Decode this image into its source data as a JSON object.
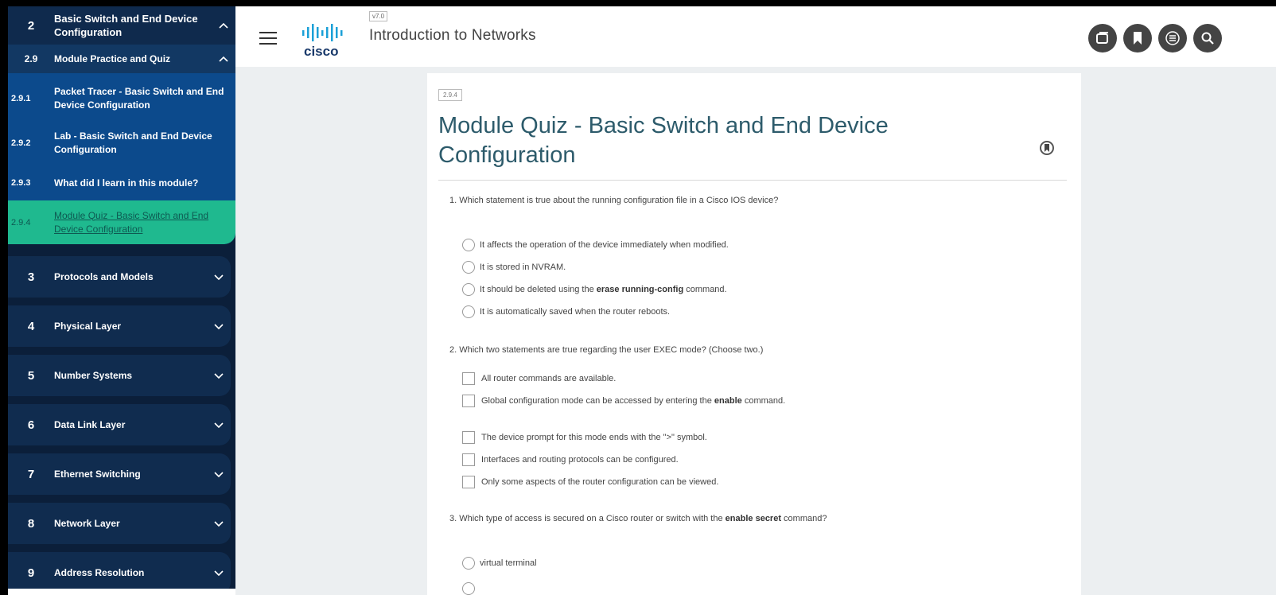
{
  "sidebar": {
    "chapter": {
      "num": "2",
      "label": "Basic Switch and End Device Configuration"
    },
    "section": {
      "num": "2.9",
      "label": "Module Practice and Quiz"
    },
    "subitems": [
      {
        "num": "2.9.1",
        "label": "Packet Tracer - Basic Switch and End Device Configuration"
      },
      {
        "num": "2.9.2",
        "label": "Lab - Basic Switch and End Device Configuration"
      },
      {
        "num": "2.9.3",
        "label": "What did I learn in this module?"
      },
      {
        "num": "2.9.4",
        "label": "Module Quiz - Basic Switch and End Device Configuration"
      }
    ],
    "modules": [
      {
        "num": "3",
        "label": "Protocols and Models"
      },
      {
        "num": "4",
        "label": "Physical Layer"
      },
      {
        "num": "5",
        "label": "Number Systems"
      },
      {
        "num": "6",
        "label": "Data Link Layer"
      },
      {
        "num": "7",
        "label": "Ethernet Switching"
      },
      {
        "num": "8",
        "label": "Network Layer"
      },
      {
        "num": "9",
        "label": "Address Resolution"
      }
    ]
  },
  "header": {
    "version": "v7.0",
    "course_title": "Introduction to Networks",
    "logo_text": "cisco",
    "buttons": [
      "copy-icon",
      "bookmark-icon",
      "list-icon",
      "search-icon"
    ]
  },
  "content": {
    "badge": "2.9.4",
    "title": "Module Quiz - Basic Switch and End Device Configuration",
    "q1": {
      "text": "1. Which statement is true about the running configuration file in a Cisco IOS device?",
      "options": [
        "It affects the operation of the device immediately when modified.",
        "It is stored in NVRAM.",
        "It should be deleted using the ",
        "It is automatically saved when the router reboots."
      ],
      "opt3_bold": "erase running-config",
      "opt3_tail": " command."
    },
    "q2": {
      "text": "2. Which two statements are true regarding the user EXEC mode? (Choose two.)",
      "options": [
        "All router commands are available.",
        "Global configuration mode can be accessed by entering the ",
        "The device prompt for this mode ends with the \">\" symbol.",
        "Interfaces and routing protocols can be configured.",
        "Only some aspects of the router configuration can be viewed."
      ],
      "opt2_bold": "enable",
      "opt2_tail": " command."
    },
    "q3": {
      "text_a": "3. Which type of access is secured on a Cisco router or switch with the ",
      "text_bold1": "enable",
      "text_bold2": "secret",
      "text_tail": " command?",
      "options": [
        "virtual terminal"
      ]
    }
  },
  "colors": {
    "sidebar_bg": "#0b1f3a",
    "sublist_bg": "#0c4a8c",
    "active_item": "#1fb98f",
    "title": "#2d5b6b"
  }
}
